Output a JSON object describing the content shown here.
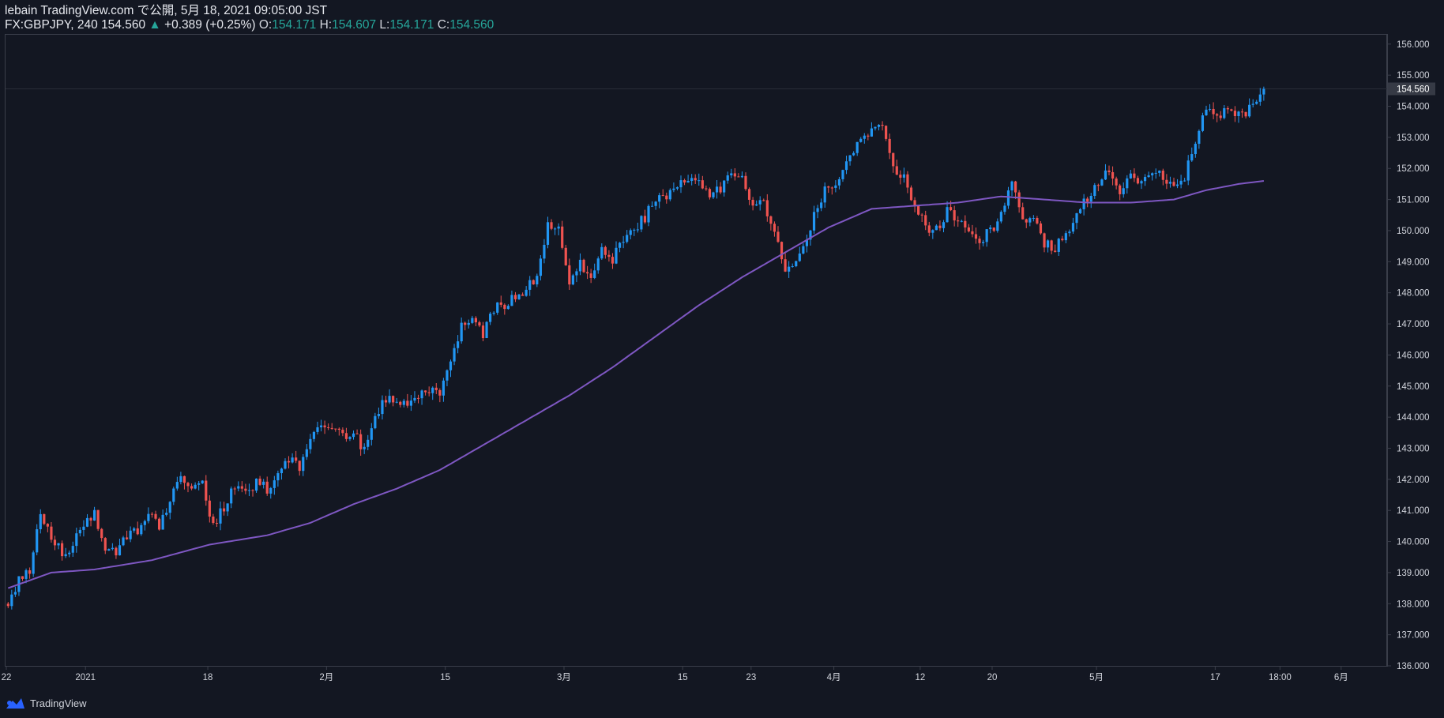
{
  "header": {
    "published_line": "lebain TradingView.com で公開, 5月 18, 2021 09:05:00 JST",
    "symbol": "FX:GBPJPY, 240",
    "last": "154.560",
    "change_arrow": "▲",
    "change": "+0.389 (+0.25%)",
    "o_label": "O:",
    "o_value": "154.171",
    "h_label": "H:",
    "h_value": "154.607",
    "l_label": "L:",
    "l_value": "154.171",
    "c_label": "C:",
    "c_value": "154.560"
  },
  "footer": {
    "brand": "TradingView"
  },
  "colors": {
    "background": "#131722",
    "up": "#2196f3",
    "down": "#ef5350",
    "ma": "#7e57c2",
    "price_tag": "#363a45",
    "axis_text": "#d1d4dc",
    "border": "#3a3e4a"
  },
  "chart_data": {
    "type": "candlestick",
    "symbol": "GBPJPY",
    "timeframe": "240",
    "ylim": [
      136.0,
      156.3
    ],
    "y_ticks": [
      "136.000",
      "137.000",
      "138.000",
      "139.000",
      "140.000",
      "141.000",
      "142.000",
      "143.000",
      "144.000",
      "145.000",
      "146.000",
      "147.000",
      "148.000",
      "149.000",
      "150.000",
      "151.000",
      "152.000",
      "153.000",
      "154.000",
      "155.000",
      "156.000"
    ],
    "last_price_label": "154.560",
    "last_price": 154.56,
    "x_ticks": [
      {
        "label": "22",
        "bar": 0
      },
      {
        "label": "2021",
        "bar": 22
      },
      {
        "label": "18",
        "bar": 56
      },
      {
        "label": "2月",
        "bar": 89
      },
      {
        "label": "15",
        "bar": 122
      },
      {
        "label": "3月",
        "bar": 155
      },
      {
        "label": "15",
        "bar": 188
      },
      {
        "label": "23",
        "bar": 207
      },
      {
        "label": "4月",
        "bar": 230
      },
      {
        "label": "12",
        "bar": 254
      },
      {
        "label": "20",
        "bar": 274
      },
      {
        "label": "5月",
        "bar": 303
      },
      {
        "label": "17",
        "bar": 336
      },
      {
        "label": "18:00",
        "bar": 354
      },
      {
        "label": "6月",
        "bar": 371
      }
    ],
    "bars_total_slots": 384,
    "price_path": [
      [
        0,
        138.0
      ],
      [
        3,
        138.8
      ],
      [
        6,
        139.0
      ],
      [
        9,
        140.9
      ],
      [
        12,
        140.2
      ],
      [
        15,
        139.6
      ],
      [
        18,
        139.9
      ],
      [
        21,
        140.6
      ],
      [
        24,
        140.9
      ],
      [
        27,
        139.8
      ],
      [
        30,
        139.7
      ],
      [
        33,
        140.1
      ],
      [
        36,
        140.4
      ],
      [
        39,
        140.9
      ],
      [
        42,
        140.4
      ],
      [
        45,
        141.4
      ],
      [
        48,
        142.0
      ],
      [
        51,
        141.6
      ],
      [
        54,
        141.8
      ],
      [
        57,
        140.5
      ],
      [
        60,
        141.1
      ],
      [
        63,
        141.8
      ],
      [
        66,
        141.5
      ],
      [
        69,
        141.9
      ],
      [
        72,
        141.7
      ],
      [
        75,
        142.1
      ],
      [
        78,
        142.6
      ],
      [
        81,
        142.4
      ],
      [
        84,
        143.3
      ],
      [
        87,
        143.8
      ],
      [
        90,
        143.6
      ],
      [
        93,
        143.4
      ],
      [
        96,
        143.6
      ],
      [
        99,
        142.9
      ],
      [
        102,
        144.1
      ],
      [
        105,
        144.6
      ],
      [
        108,
        144.6
      ],
      [
        111,
        144.3
      ],
      [
        114,
        144.7
      ],
      [
        117,
        144.9
      ],
      [
        120,
        144.7
      ],
      [
        123,
        145.7
      ],
      [
        126,
        146.9
      ],
      [
        129,
        147.2
      ],
      [
        132,
        146.6
      ],
      [
        135,
        147.5
      ],
      [
        138,
        147.6
      ],
      [
        141,
        147.9
      ],
      [
        144,
        148.1
      ],
      [
        147,
        148.6
      ],
      [
        150,
        150.1
      ],
      [
        153,
        150.2
      ],
      [
        156,
        148.3
      ],
      [
        159,
        149.0
      ],
      [
        162,
        148.4
      ],
      [
        165,
        149.4
      ],
      [
        168,
        149.1
      ],
      [
        171,
        149.8
      ],
      [
        174,
        150.1
      ],
      [
        177,
        150.4
      ],
      [
        180,
        151.1
      ],
      [
        183,
        151.0
      ],
      [
        186,
        151.5
      ],
      [
        189,
        151.7
      ],
      [
        192,
        151.6
      ],
      [
        195,
        151.1
      ],
      [
        198,
        151.4
      ],
      [
        201,
        151.9
      ],
      [
        204,
        151.8
      ],
      [
        207,
        150.8
      ],
      [
        210,
        150.9
      ],
      [
        213,
        149.8
      ],
      [
        216,
        148.8
      ],
      [
        219,
        149.0
      ],
      [
        222,
        149.8
      ],
      [
        225,
        150.8
      ],
      [
        228,
        151.5
      ],
      [
        231,
        151.6
      ],
      [
        234,
        152.3
      ],
      [
        237,
        152.9
      ],
      [
        240,
        153.3
      ],
      [
        243,
        153.3
      ],
      [
        246,
        152.0
      ],
      [
        249,
        151.8
      ],
      [
        252,
        150.8
      ],
      [
        255,
        150.1
      ],
      [
        258,
        150.0
      ],
      [
        261,
        150.6
      ],
      [
        264,
        150.4
      ],
      [
        267,
        150.0
      ],
      [
        270,
        149.7
      ],
      [
        273,
        150.0
      ],
      [
        276,
        150.5
      ],
      [
        279,
        151.7
      ],
      [
        282,
        150.4
      ],
      [
        285,
        150.3
      ],
      [
        288,
        149.6
      ],
      [
        291,
        149.4
      ],
      [
        294,
        149.9
      ],
      [
        297,
        150.4
      ],
      [
        300,
        151.1
      ],
      [
        303,
        151.5
      ],
      [
        306,
        152.0
      ],
      [
        309,
        151.2
      ],
      [
        312,
        151.7
      ],
      [
        315,
        151.6
      ],
      [
        318,
        151.9
      ],
      [
        321,
        151.8
      ],
      [
        324,
        151.4
      ],
      [
        327,
        151.7
      ],
      [
        330,
        152.9
      ],
      [
        333,
        153.9
      ],
      [
        336,
        153.6
      ],
      [
        339,
        154.0
      ],
      [
        342,
        153.7
      ],
      [
        345,
        153.9
      ],
      [
        347,
        154.2
      ],
      [
        349,
        154.56
      ]
    ],
    "ma_path": [
      [
        0,
        138.5
      ],
      [
        12,
        139.0
      ],
      [
        24,
        139.1
      ],
      [
        40,
        139.4
      ],
      [
        56,
        139.9
      ],
      [
        72,
        140.2
      ],
      [
        84,
        140.6
      ],
      [
        96,
        141.2
      ],
      [
        108,
        141.7
      ],
      [
        120,
        142.3
      ],
      [
        132,
        143.1
      ],
      [
        144,
        143.9
      ],
      [
        156,
        144.7
      ],
      [
        168,
        145.6
      ],
      [
        180,
        146.6
      ],
      [
        192,
        147.6
      ],
      [
        204,
        148.5
      ],
      [
        216,
        149.3
      ],
      [
        228,
        150.1
      ],
      [
        240,
        150.7
      ],
      [
        252,
        150.8
      ],
      [
        264,
        150.9
      ],
      [
        276,
        151.1
      ],
      [
        288,
        151.0
      ],
      [
        300,
        150.9
      ],
      [
        312,
        150.9
      ],
      [
        324,
        151.0
      ],
      [
        333,
        151.3
      ],
      [
        342,
        151.5
      ],
      [
        349,
        151.6
      ]
    ]
  }
}
